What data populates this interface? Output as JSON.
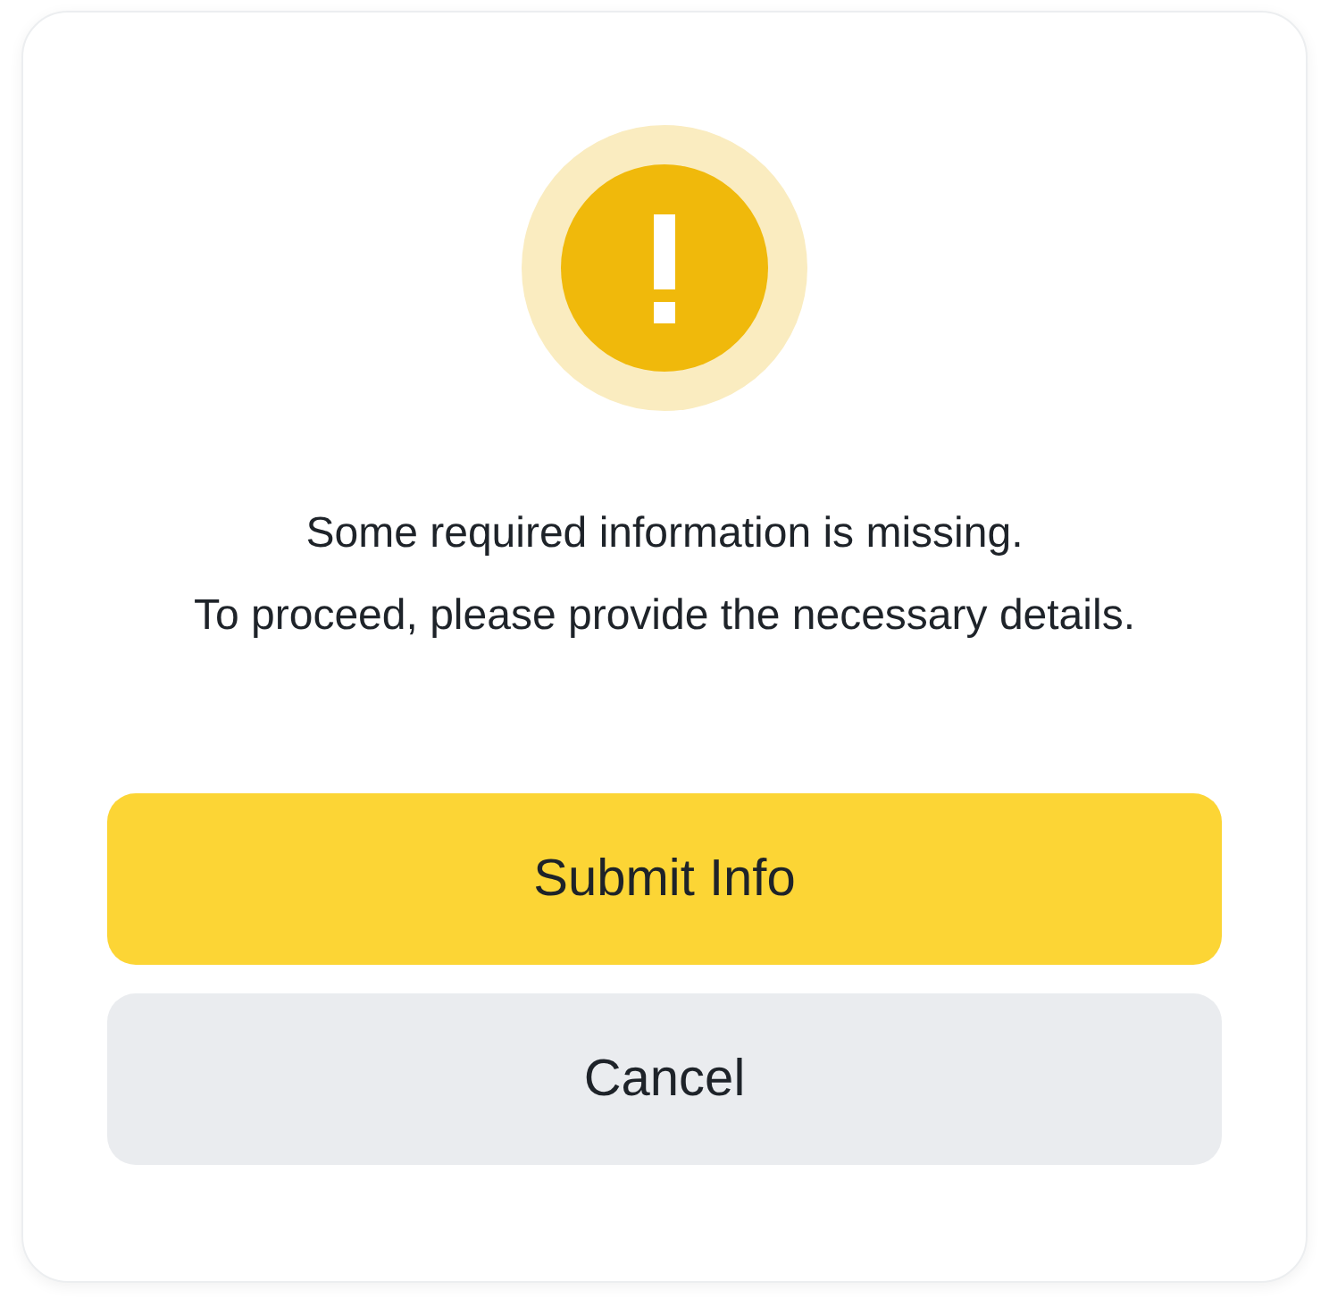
{
  "dialog": {
    "message_lines": [
      "Some required information is missing.",
      "To proceed, please provide the necessary details."
    ],
    "buttons": [
      {
        "label": "Submit Info",
        "kind": "primary"
      },
      {
        "label": "Cancel",
        "kind": "secondary"
      }
    ]
  }
}
